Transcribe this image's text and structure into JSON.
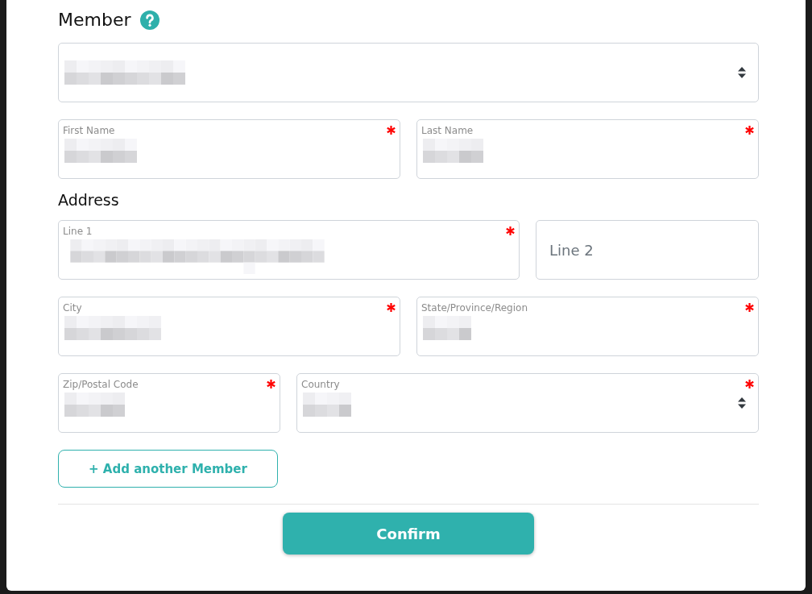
{
  "member": {
    "title": "Member",
    "select": {
      "kind": "select",
      "redacted": true,
      "required": false
    },
    "fields": [
      {
        "kind": "text",
        "label": "First Name",
        "redacted": true,
        "required": true
      },
      {
        "kind": "text",
        "label": "Last Name",
        "redacted": true,
        "required": true
      }
    ]
  },
  "address": {
    "title": "Address",
    "rows": [
      [
        {
          "kind": "text",
          "label": "Line 1",
          "redacted": true,
          "required": true
        },
        {
          "kind": "text",
          "placeholder": "Line 2",
          "redacted": false,
          "required": false
        }
      ],
      [
        {
          "kind": "text",
          "label": "City",
          "redacted": true,
          "required": true
        },
        {
          "kind": "text",
          "label": "State/Province/Region",
          "redacted": true,
          "required": true
        }
      ],
      [
        {
          "kind": "text",
          "label": "Zip/Postal Code",
          "redacted": true,
          "required": true
        },
        {
          "kind": "select",
          "label": "Country",
          "redacted": true,
          "required": true
        }
      ]
    ]
  },
  "add_button": {
    "label": "+ Add another Member"
  },
  "confirm_button": {
    "label": "Confirm"
  }
}
